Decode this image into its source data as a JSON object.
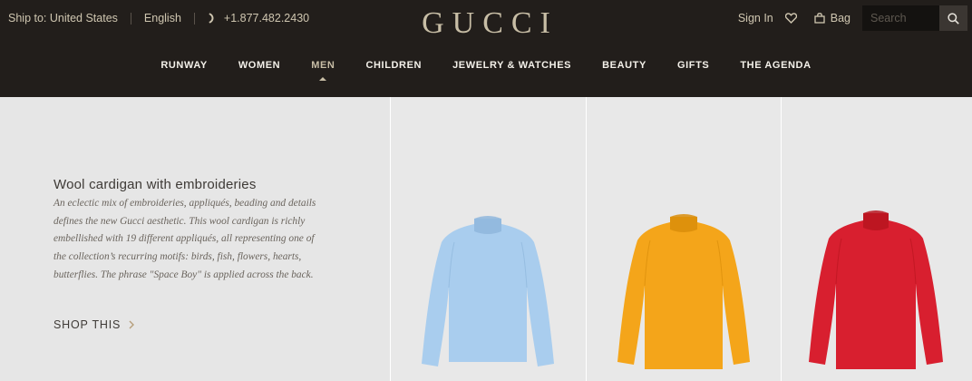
{
  "header": {
    "ship_to": "Ship to: United States",
    "language": "English",
    "phone": "+1.877.482.2430",
    "logo": "GUCCI",
    "sign_in": "Sign In",
    "bag": "Bag",
    "search_placeholder": "Search"
  },
  "nav": {
    "items": [
      "RUNWAY",
      "WOMEN",
      "MEN",
      "CHILDREN",
      "JEWELRY & WATCHES",
      "BEAUTY",
      "GIFTS",
      "THE AGENDA"
    ],
    "active": "MEN"
  },
  "promo": {
    "title": "Wool cardigan with embroideries",
    "description_lines": [
      "An eclectic mix of embroideries, appliqués, beading and details",
      "defines the new Gucci aesthetic. This wool cardigan is richly",
      "embellished with 19 different appliqués, all representing one of",
      "the collection’s recurring motifs: birds, fish, flowers, hearts,",
      "butterflies. The phrase \"Space Boy\" is applied across the back."
    ],
    "cta": "SHOP THIS"
  },
  "products": [
    {
      "color": "#a9cdee",
      "shade": "#8fb6dc"
    },
    {
      "color": "#f4a51a",
      "shade": "#d98d0a"
    },
    {
      "color": "#d81f2f",
      "shade": "#b9151f"
    }
  ],
  "icons": {
    "phone": "phone-icon",
    "wishlist": "heart-icon",
    "bag": "bag-icon",
    "search": "search-icon",
    "cta_arrow": "chevron-right-icon"
  },
  "colors": {
    "header_bg": "#221e1b",
    "gold": "#c8bea6"
  }
}
